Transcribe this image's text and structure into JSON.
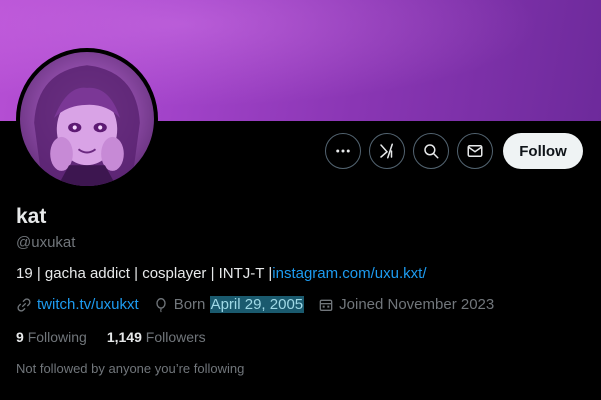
{
  "profile": {
    "display_name": "kat",
    "handle": "@uxukat",
    "bio_text": "19 | gacha addict | cosplayer | INTJ-T |",
    "bio_link": "instagram.com/uxu.kxt/",
    "website": "twitch.tv/uxukxt",
    "born_label": "Born",
    "born_date": "April 29, 2005",
    "joined": "Joined November 2023",
    "following_count": "9",
    "following_label": "Following",
    "followers_count": "1,149",
    "followers_label": "Followers",
    "not_followed": "Not followed by anyone you’re following"
  },
  "actions": {
    "more_icon": "more-dots-icon",
    "grok_icon": "grok-icon",
    "search_icon": "search-icon",
    "message_icon": "envelope-icon",
    "follow_label": "Follow"
  },
  "colors": {
    "banner": "#a243c9",
    "link": "#1d9bf0",
    "secondary_text": "#71767b",
    "follow_button_bg": "#eff3f4"
  }
}
